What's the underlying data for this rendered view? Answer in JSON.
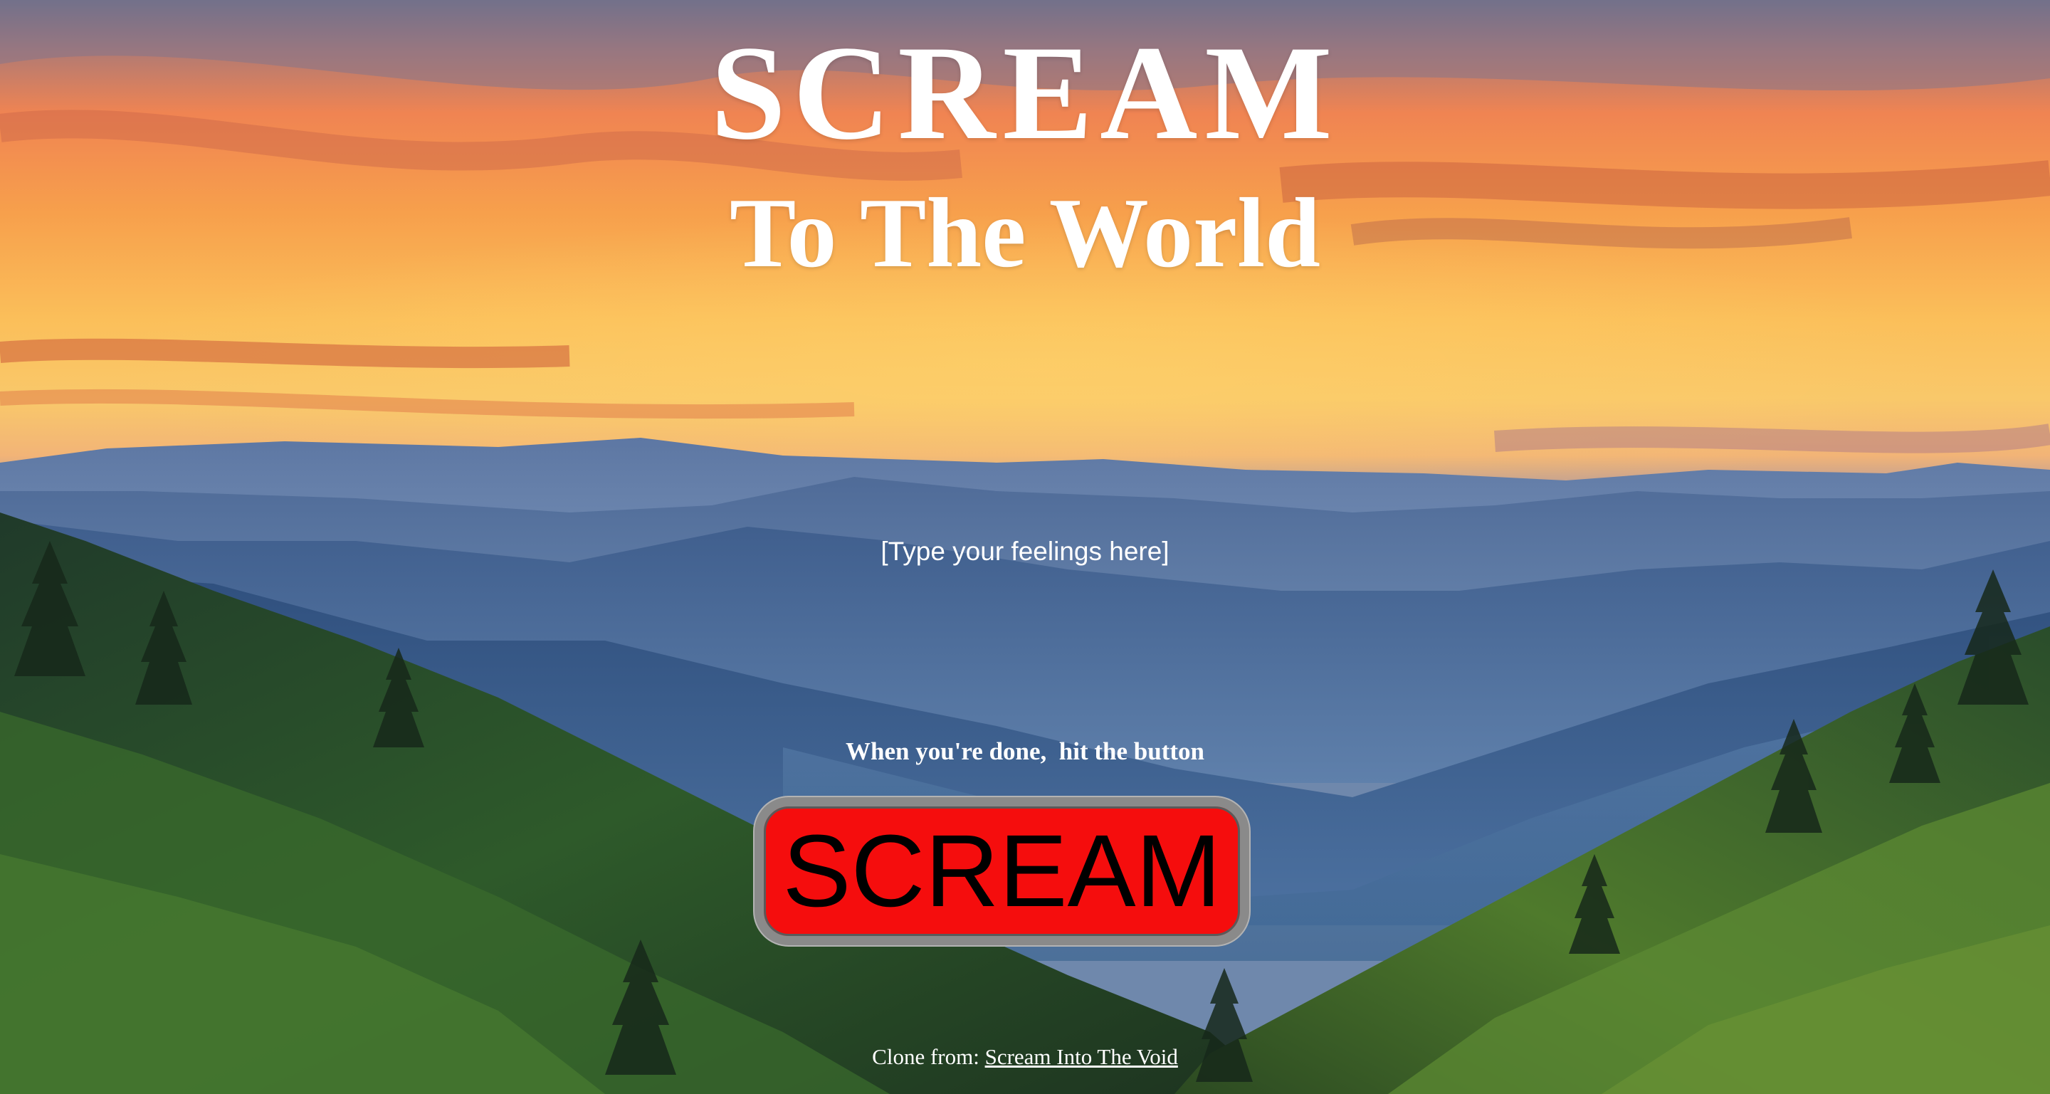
{
  "header": {
    "title": "SCREAM",
    "subtitle": "To The World"
  },
  "input": {
    "placeholder": "[Type your feelings here]",
    "value": ""
  },
  "hint": "When you're done,  hit the button",
  "button": {
    "label": "SCREAM",
    "color": "#f50d0d"
  },
  "footer": {
    "prefix": "Clone from:",
    "link_text": "Scream Into The Void"
  },
  "background": {
    "description": "sunset-mountain-landscape"
  }
}
